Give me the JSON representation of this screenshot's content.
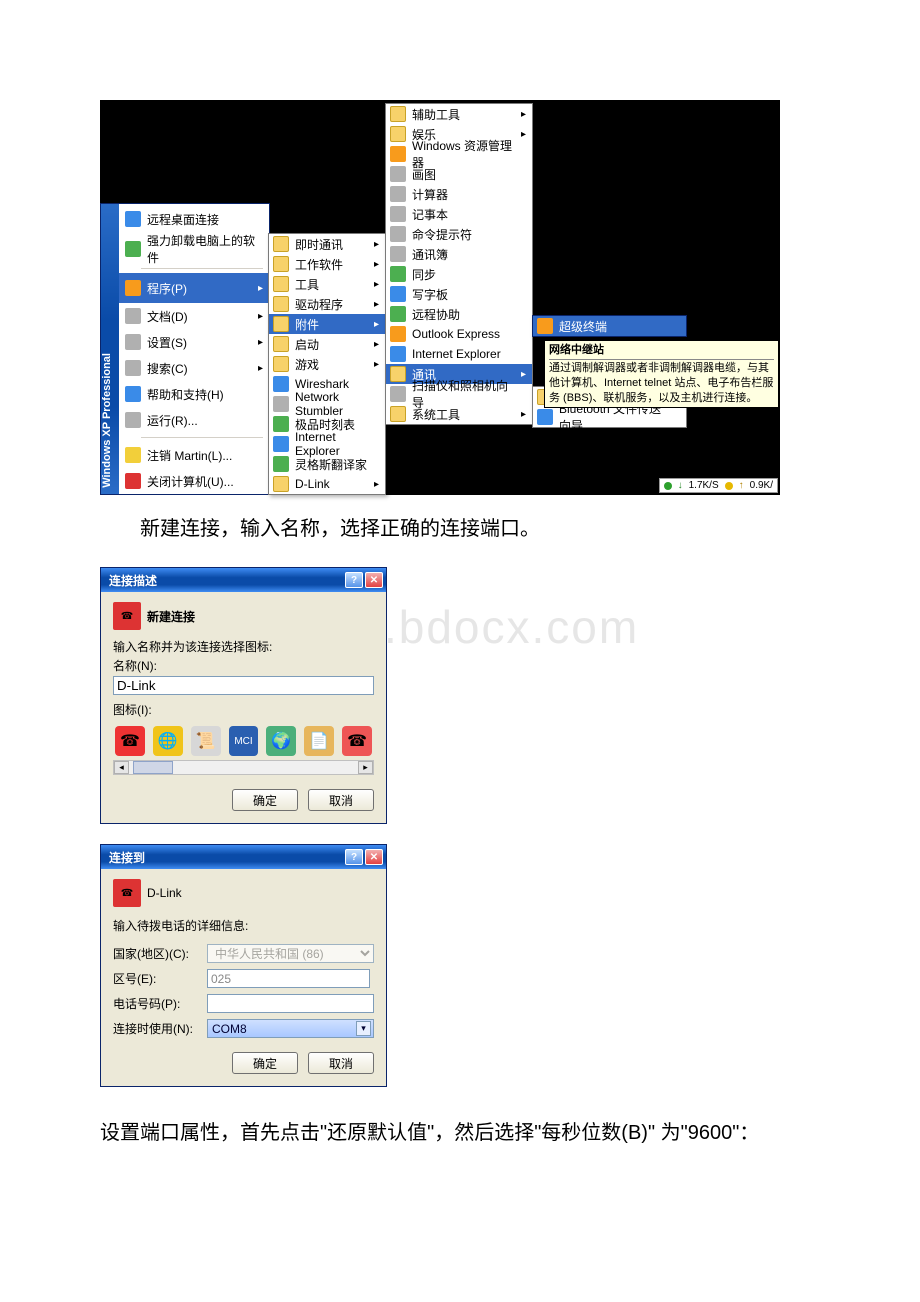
{
  "watermark": "www.bdocx.com",
  "instructions": {
    "p1": "新建连接，输入名称，选择正确的连接端口。",
    "p2": "设置端口属性，首先点击\"还原默认值\"，然后选择\"每秒位数(B)\" 为\"9600\"："
  },
  "start_menu": {
    "side_title": "Windows XP Professional",
    "items": [
      {
        "label": "远程桌面连接",
        "icon": "blue"
      },
      {
        "label": "强力卸载电脑上的软件",
        "icon": "green"
      },
      {
        "label": "程序(P)",
        "icon": "orange",
        "hl": true,
        "arrow": true,
        "tall": true
      },
      {
        "label": "文档(D)",
        "icon": "gray",
        "arrow": true
      },
      {
        "label": "设置(S)",
        "icon": "gray",
        "arrow": true
      },
      {
        "label": "搜索(C)",
        "icon": "gray",
        "arrow": true
      },
      {
        "label": "帮助和支持(H)",
        "icon": "blue"
      },
      {
        "label": "运行(R)...",
        "icon": "gray"
      },
      {
        "label": "注销 Martin(L)...",
        "icon": "yellow"
      },
      {
        "label": "关闭计算机(U)...",
        "icon": "red"
      }
    ]
  },
  "sub1": [
    {
      "label": "即时通讯",
      "icon": "folder",
      "arrow": true
    },
    {
      "label": "工作软件",
      "icon": "folder",
      "arrow": true
    },
    {
      "label": "工具",
      "icon": "folder",
      "arrow": true
    },
    {
      "label": "驱动程序",
      "icon": "folder",
      "arrow": true
    },
    {
      "label": "附件",
      "icon": "folder",
      "arrow": true,
      "hl": true
    },
    {
      "label": "启动",
      "icon": "folder",
      "arrow": true
    },
    {
      "label": "游戏",
      "icon": "folder",
      "arrow": true
    },
    {
      "label": "Wireshark",
      "icon": "blue"
    },
    {
      "label": "Network Stumbler",
      "icon": "gray"
    },
    {
      "label": "极品时刻表",
      "icon": "green"
    },
    {
      "label": "Internet Explorer",
      "icon": "blue"
    },
    {
      "label": "灵格斯翻译家",
      "icon": "green"
    },
    {
      "label": "D-Link",
      "icon": "folder",
      "arrow": true
    }
  ],
  "sub2": [
    {
      "label": "辅助工具",
      "icon": "folder",
      "arrow": true
    },
    {
      "label": "娱乐",
      "icon": "folder",
      "arrow": true
    },
    {
      "label": "Windows 资源管理器",
      "icon": "orange"
    },
    {
      "label": "画图",
      "icon": "gray"
    },
    {
      "label": "计算器",
      "icon": "gray"
    },
    {
      "label": "记事本",
      "icon": "gray"
    },
    {
      "label": "命令提示符",
      "icon": "gray"
    },
    {
      "label": "通讯簿",
      "icon": "gray"
    },
    {
      "label": "同步",
      "icon": "green"
    },
    {
      "label": "写字板",
      "icon": "blue"
    },
    {
      "label": "远程协助",
      "icon": "green"
    },
    {
      "label": "Outlook Express",
      "icon": "orange"
    },
    {
      "label": "Internet Explorer",
      "icon": "blue"
    },
    {
      "label": "通讯",
      "icon": "folder",
      "arrow": true,
      "hl": true
    },
    {
      "label": "扫描仪和照相机向导",
      "icon": "gray"
    },
    {
      "label": "系统工具",
      "icon": "folder",
      "arrow": true
    }
  ],
  "sub3_title": "超级终端",
  "sub3": [
    {
      "label": "超级终端",
      "icon": "folder",
      "arrow": true
    },
    {
      "label": "Bluetooth 文件传送向导",
      "icon": "blue"
    }
  ],
  "tooltip": {
    "title": "网络中继站",
    "body": "通过调制解调器或者非调制解调器电缆，与其他计算机、Internet telnet 站点、电子布告栏服务 (BBS)、联机服务，以及主机进行连接。"
  },
  "net_indicator": {
    "up": "1.7K/S",
    "down": "0.9K/"
  },
  "dialog1": {
    "title": "连接描述",
    "heading": "新建连接",
    "prompt": "输入名称并为该连接选择图标:",
    "name_label": "名称(N):",
    "name_value": "D-Link",
    "icons_label": "图标(I):",
    "ok": "确定",
    "cancel": "取消"
  },
  "dialog2": {
    "title": "连接到",
    "heading": "D-Link",
    "prompt": "输入待拨电话的详细信息:",
    "country_label": "国家(地区)(C):",
    "country_value": "中华人民共和国 (86)",
    "area_label": "区号(E):",
    "area_value": "025",
    "phone_label": "电话号码(P):",
    "connect_label": "连接时使用(N):",
    "connect_value": "COM8",
    "ok": "确定",
    "cancel": "取消"
  }
}
